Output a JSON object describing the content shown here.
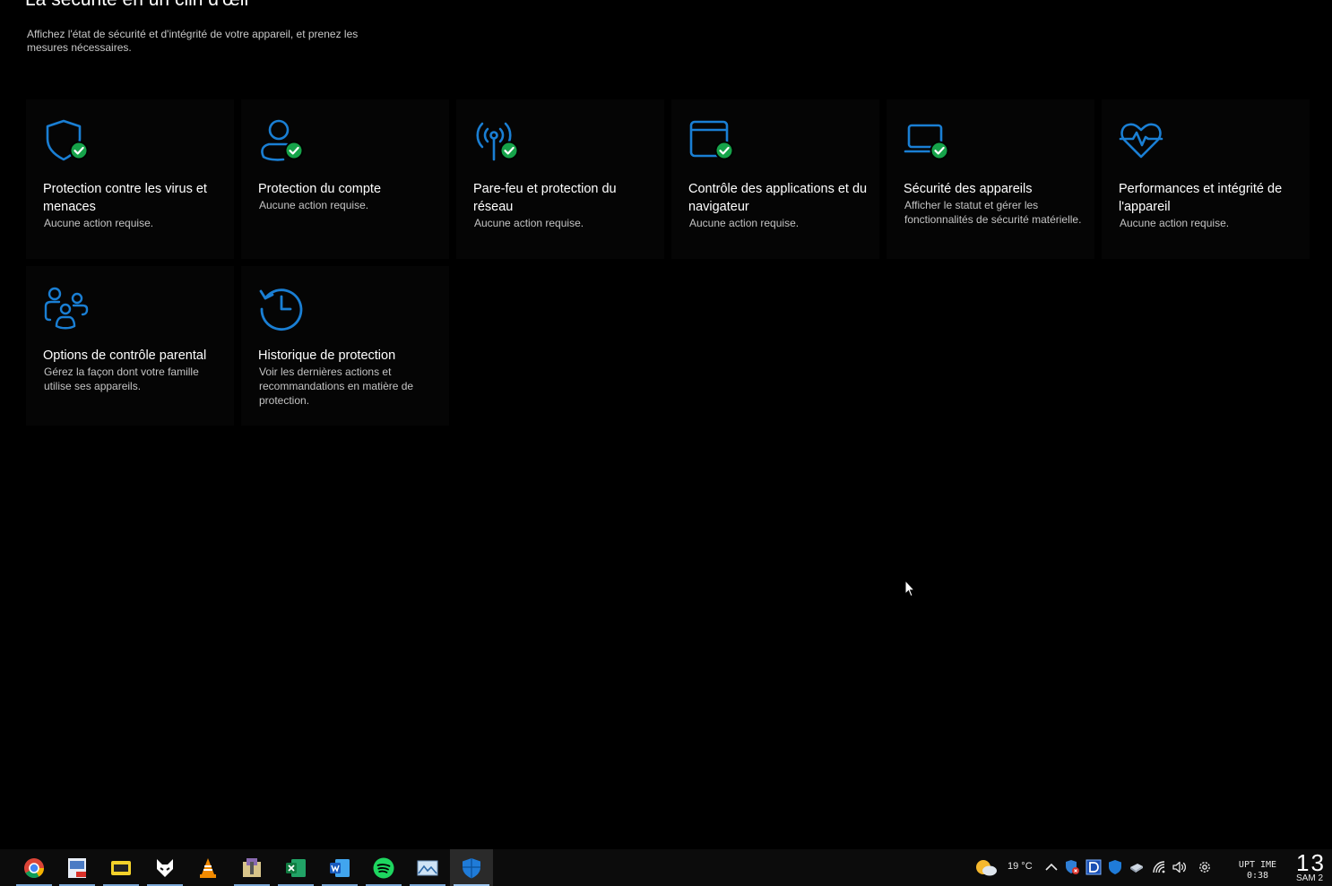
{
  "header": {
    "title": "La sécurité en un clin d'œil",
    "subtitle": "Affichez l'état de sécurité et d'intégrité de votre appareil, et prenez les mesures nécessaires."
  },
  "colors": {
    "accent_blue": "#1a7fd4",
    "status_green": "#16a34a",
    "tile_background": "#050505"
  },
  "tiles": [
    {
      "icon": "shield-icon",
      "status": "ok",
      "title": "Protection contre les virus et menaces",
      "desc": "Aucune action requise."
    },
    {
      "icon": "account-icon",
      "status": "ok",
      "title": "Protection du compte",
      "desc": "Aucune action requise."
    },
    {
      "icon": "antenna-icon",
      "status": "ok",
      "title": "Pare-feu et protection du réseau",
      "desc": "Aucune action requise."
    },
    {
      "icon": "browser-window-icon",
      "status": "ok",
      "title": "Contrôle des applications et du navigateur",
      "desc": "Aucune action requise."
    },
    {
      "icon": "laptop-icon",
      "status": "ok",
      "title": "Sécurité des appareils",
      "desc": "Afficher le statut et gérer les fonctionnalités de sécurité matérielle."
    },
    {
      "icon": "heart-pulse-icon",
      "status": "none",
      "title": "Performances et intégrité de l'appareil",
      "desc": "Aucune action requise."
    },
    {
      "icon": "family-icon",
      "status": "none",
      "title": "Options de contrôle parental",
      "desc": "Gérez la façon dont votre famille utilise ses appareils."
    },
    {
      "icon": "history-icon",
      "status": "none",
      "title": "Historique de protection",
      "desc": "Voir les dernières actions et recommandations en matière de protection."
    }
  ],
  "taskbar": {
    "apps": [
      {
        "icon": "chrome-icon",
        "running": true,
        "active": false
      },
      {
        "icon": "pdf-editor-icon",
        "running": true,
        "active": false
      },
      {
        "icon": "pdf-viewer-icon",
        "running": true,
        "active": false
      },
      {
        "icon": "fox-app-icon",
        "running": true,
        "active": false
      },
      {
        "icon": "vlc-icon",
        "running": false,
        "active": false
      },
      {
        "icon": "archive-icon",
        "running": true,
        "active": false
      },
      {
        "icon": "excel-icon",
        "running": true,
        "active": false
      },
      {
        "icon": "word-icon",
        "running": true,
        "active": false
      },
      {
        "icon": "spotify-icon",
        "running": true,
        "active": false
      },
      {
        "icon": "image-viewer-icon",
        "running": true,
        "active": false
      },
      {
        "icon": "windows-security-icon",
        "running": true,
        "active": true
      }
    ],
    "tray": {
      "weather_icon": "weather-partly-cloudy-icon",
      "temperature": "19 °C",
      "uptime_label": "UPT IME",
      "uptime_value": "0:38",
      "clock_time": "13",
      "clock_day": "SAM 2"
    }
  }
}
